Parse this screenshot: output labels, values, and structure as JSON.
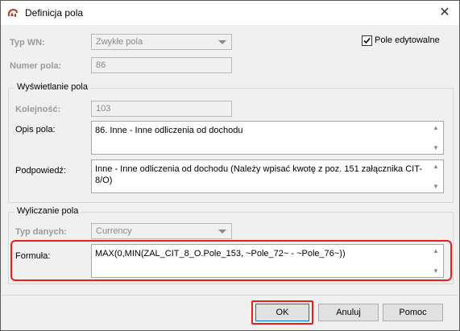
{
  "window": {
    "title": "Definicja pola",
    "close_glyph": "✕",
    "icon": "sygnity-app-icon"
  },
  "header": {
    "typ_wn_label": "Typ WN:",
    "typ_wn_value": "Zwykłe pola",
    "numer_pola_label": "Numer pola:",
    "numer_pola_value": "86",
    "pole_edytowalne_label": "Pole edytowalne",
    "pole_edytowalne_checked": true
  },
  "wyswietlanie": {
    "group_title": "Wyświetlanie pola",
    "kolejnosc_label": "Kolejność:",
    "kolejnosc_value": "103",
    "opis_label": "Opis pola:",
    "opis_value": "86. Inne - Inne odliczenia od dochodu",
    "podpowiedz_label": "Podpowiedź:",
    "podpowiedz_value": "Inne - Inne odliczenia od dochodu (Należy wpisać kwotę z poz. 151 załącznika CIT-8/O)"
  },
  "wyliczanie": {
    "group_title": "Wyliczanie pola",
    "typ_danych_label": "Typ danych:",
    "typ_danych_value": "Currency",
    "formula_label": "Formuła:",
    "formula_value": "MAX(0,MIN(ZAL_CIT_8_O.Pole_153, ~Pole_72~ - ~Pole_76~))"
  },
  "buttons": {
    "ok": "OK",
    "anuluj": "Anuluj",
    "pomoc": "Pomoc"
  },
  "colors": {
    "highlight": "#e8201b",
    "dialog_bg": "#f0f0f0",
    "default_button_border": "#0078d7"
  }
}
